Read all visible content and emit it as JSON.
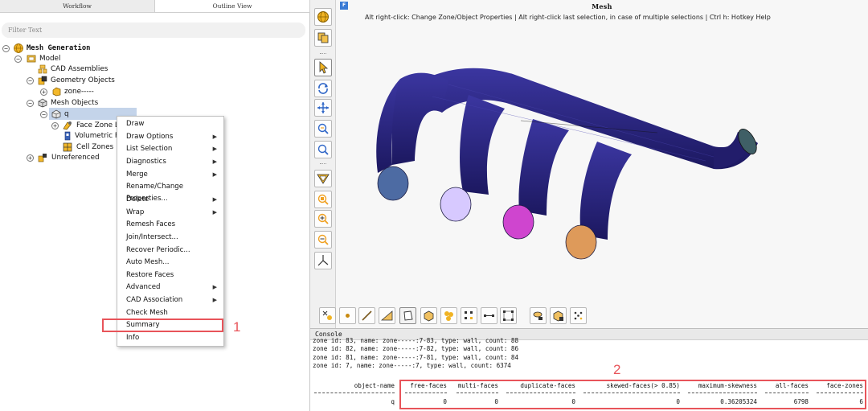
{
  "tabs": {
    "workflow": "Workflow",
    "outline": "Outline View"
  },
  "filter": {
    "placeholder": "Filter Text"
  },
  "tree": {
    "root": "Mesh Generation",
    "model": "Model",
    "cad_assemblies": "CAD Assemblies",
    "geometry_objects": "Geometry Objects",
    "zone": "zone-----",
    "mesh_objects": "Mesh Objects",
    "q": "q",
    "face_zone": "Face Zone La",
    "volumetric": "Volumetric R",
    "cell_zones": "Cell Zones",
    "unreferenced": "Unreferenced"
  },
  "context_menu": [
    {
      "label": "Draw",
      "submenu": false
    },
    {
      "label": "Draw Options",
      "submenu": true
    },
    {
      "label": "List Selection",
      "submenu": true
    },
    {
      "label": "Diagnostics",
      "submenu": true
    },
    {
      "label": "Merge",
      "submenu": true
    },
    {
      "label": "Rename/Change Properties...",
      "submenu": false
    },
    {
      "label": "Delete",
      "submenu": true
    },
    {
      "label": "Wrap",
      "submenu": true
    },
    {
      "label": "Remesh Faces",
      "submenu": false
    },
    {
      "label": "Join/Intersect...",
      "submenu": false
    },
    {
      "label": "Recover Periodic...",
      "submenu": false
    },
    {
      "label": "Auto Mesh...",
      "submenu": false
    },
    {
      "label": "Restore Faces",
      "submenu": false
    },
    {
      "label": "Advanced",
      "submenu": true
    },
    {
      "label": "CAD Association",
      "submenu": true
    },
    {
      "label": "Check Mesh",
      "submenu": false
    },
    {
      "label": "Summary",
      "submenu": false
    },
    {
      "label": "Info",
      "submenu": false
    }
  ],
  "annotations": {
    "one": "1",
    "two": "2"
  },
  "viewport": {
    "badge": "F",
    "title": "Mesh",
    "hint": "Alt right-click: Change Zone/Object Properties | Alt right-click last selection, in case of multiple selections | Ctrl h: Hotkey Help"
  },
  "console": {
    "title": "Console",
    "lines": [
      "zone id: 83, name: zone-----:7-83, type: wall, count: 88",
      "zone id: 82, name: zone-----:7-82, type: wall, count: 86",
      "zone id: 81, name: zone-----:7-81, type: wall, count: 84",
      "zone id: 7, name: zone-----:7, type: wall, count: 6374"
    ],
    "columns": [
      "object-name",
      "free-faces",
      "multi-faces",
      "duplicate-faces",
      "skewed-faces(> 0.85)",
      "maximum-skewness",
      "all-faces",
      "face-zones"
    ],
    "row": [
      "q",
      "0",
      "0",
      "0",
      "0",
      "0.36205324",
      "6798",
      "6"
    ]
  },
  "colors": {
    "accent": "#e8545a",
    "mesh_body": "#2a2472",
    "inlet_1": "#4d6ba3",
    "inlet_2": "#d7c9ff",
    "inlet_3": "#cf45cf",
    "inlet_4": "#de9a5a",
    "outlet": "#3f5f66"
  }
}
